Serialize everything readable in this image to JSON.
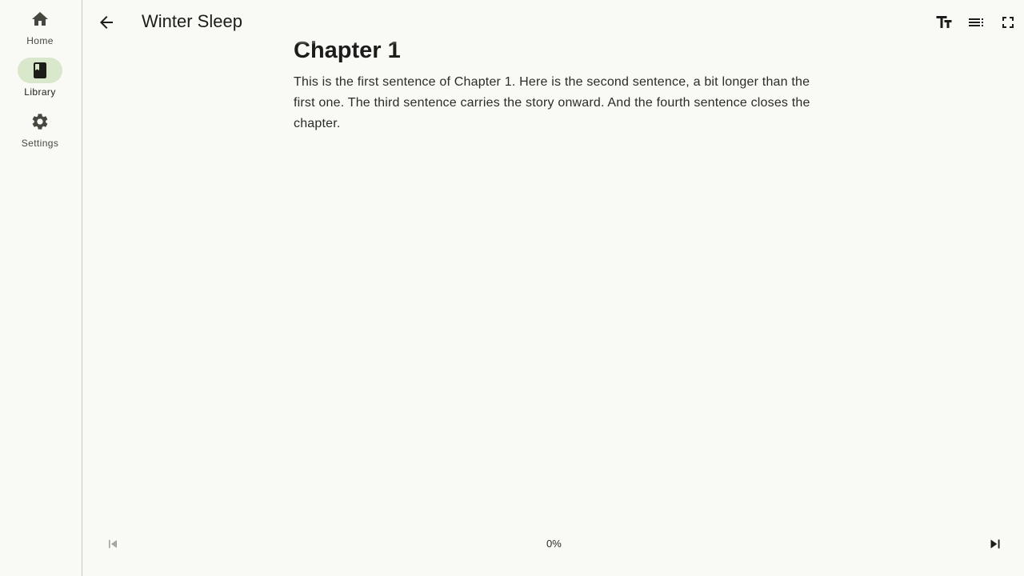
{
  "nav": {
    "items": [
      {
        "label": "Home",
        "icon": "home-icon",
        "active": false
      },
      {
        "label": "Library",
        "icon": "book-icon",
        "active": true
      },
      {
        "label": "Settings",
        "icon": "gear-icon",
        "active": false
      }
    ]
  },
  "header": {
    "title": "Winter Sleep",
    "back_icon": "arrow-back-icon",
    "actions": [
      "text-size-icon",
      "table-of-contents-icon",
      "fullscreen-icon"
    ]
  },
  "reader": {
    "chapter_title": "Chapter 1",
    "paragraph": "This is the first sentence of Chapter 1. Here is the second sentence, a bit longer than the first one. The third sentence carries the story onward. And the fourth sentence closes the chapter."
  },
  "footer": {
    "progress": "0%",
    "prev_icon": "skip-previous-icon",
    "next_icon": "skip-next-icon",
    "prev_disabled": true
  },
  "colors": {
    "background": "#f9faf5",
    "active_pill": "#d9e7cb",
    "icon": "#44483e",
    "divider": "#c5c8bd"
  }
}
